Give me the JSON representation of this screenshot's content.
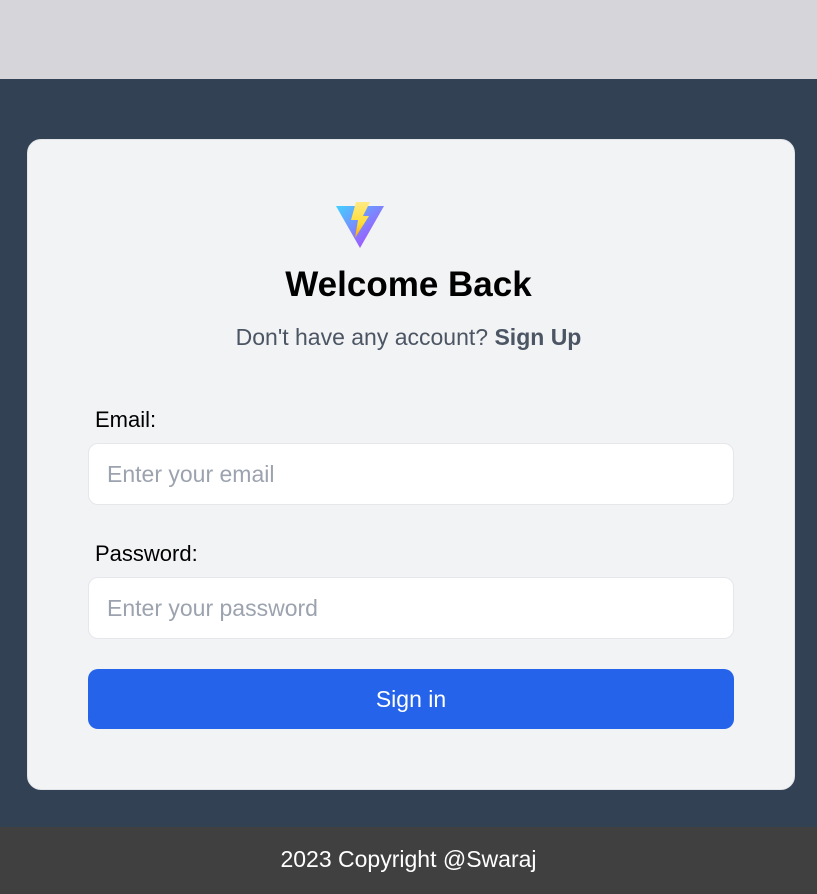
{
  "logo": {
    "icon": "vite-logo-icon"
  },
  "heading": "Welcome Back",
  "subtitle": {
    "prompt": "Don't have any account? ",
    "link": "Sign Up"
  },
  "form": {
    "email_label": "Email:",
    "email_placeholder": "Enter your email",
    "email_value": "",
    "password_label": "Password:",
    "password_placeholder": "Enter your password",
    "password_value": "",
    "submit_label": "Sign in"
  },
  "footer": {
    "text": "2023 Copyright @Swaraj"
  },
  "colors": {
    "topbar": "#d6d5d9",
    "background": "#334155",
    "card": "#f2f3f5",
    "button": "#2563eb",
    "footer": "#404040"
  }
}
